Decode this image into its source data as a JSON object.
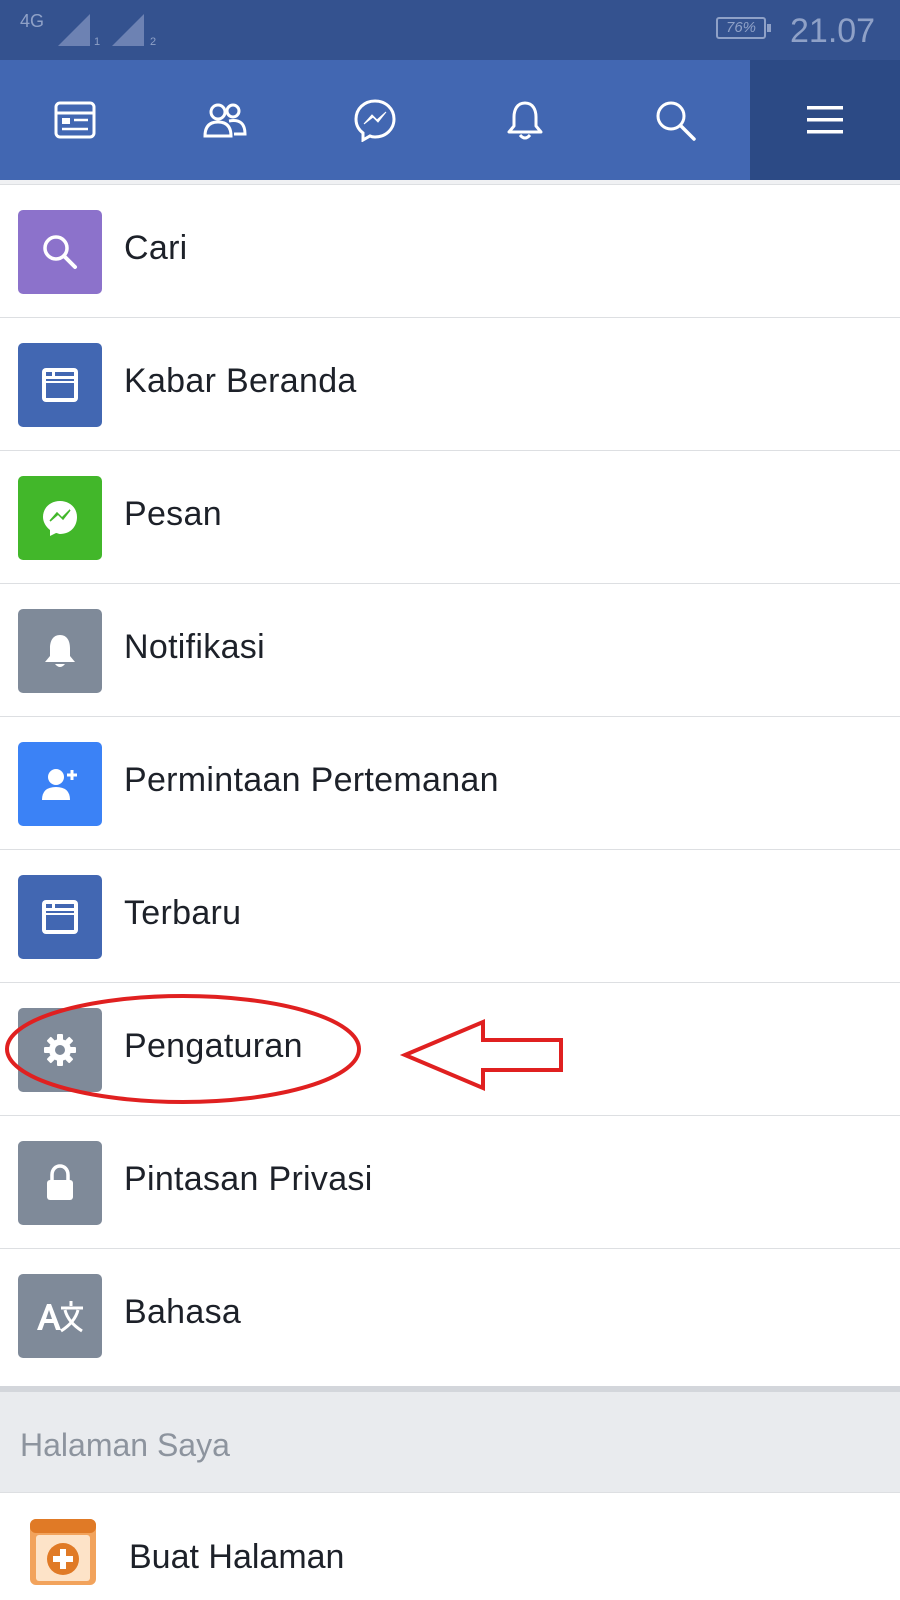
{
  "status_bar": {
    "network": "4G",
    "sim1": "1",
    "sim2": "2",
    "battery": "76%",
    "battery_level_percent": 76,
    "time": "21.07"
  },
  "nav_bar": {
    "tabs": [
      {
        "icon": "news-feed-icon",
        "active": false
      },
      {
        "icon": "friends-icon",
        "active": false
      },
      {
        "icon": "messenger-icon",
        "active": false
      },
      {
        "icon": "bell-icon",
        "active": false
      },
      {
        "icon": "search-icon",
        "active": false
      },
      {
        "icon": "menu-icon",
        "active": true
      }
    ]
  },
  "menu": {
    "items": [
      {
        "label": "Cari",
        "icon": "search-icon",
        "color": "#8c72cb"
      },
      {
        "label": "Kabar Beranda",
        "icon": "news-feed-icon",
        "color": "#4267b2"
      },
      {
        "label": "Pesan",
        "icon": "messenger-icon",
        "color": "#42b72a"
      },
      {
        "label": "Notifikasi",
        "icon": "bell-icon",
        "color": "#7f8a99"
      },
      {
        "label": "Permintaan Pertemanan",
        "icon": "add-friend-icon",
        "color": "#3b82f6"
      },
      {
        "label": "Terbaru",
        "icon": "news-feed-icon",
        "color": "#4267b2"
      },
      {
        "label": "Pengaturan",
        "icon": "gear-icon",
        "color": "#7f8a99"
      },
      {
        "label": "Pintasan Privasi",
        "icon": "lock-icon",
        "color": "#7f8a99"
      },
      {
        "label": "Bahasa",
        "icon": "translate-icon",
        "color": "#7f8a99"
      }
    ]
  },
  "my_pages": {
    "title": "Halaman Saya",
    "create_page_label": "Buat Halaman",
    "create_page_icon": "create-page-icon"
  },
  "annotation": {
    "color": "#e02020"
  }
}
